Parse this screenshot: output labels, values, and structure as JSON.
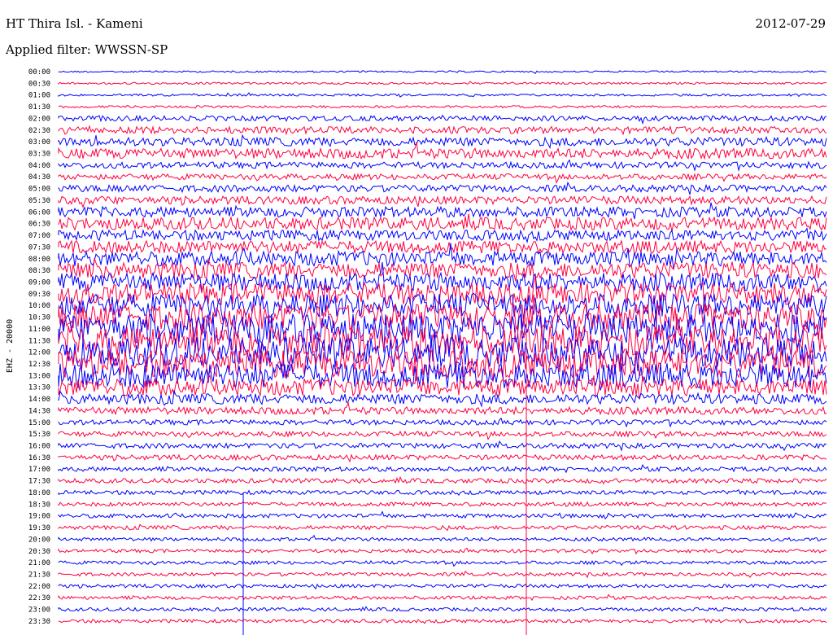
{
  "header": {
    "station": "HT Thira Isl. - Kameni",
    "date": "2012-07-29",
    "filter": "Applied filter: WWSSN-SP"
  },
  "chart_data": {
    "type": "line",
    "title": "HT Thira Isl. - Kameni",
    "date": "2012-07-29",
    "ylabel": "EHZ - 20000",
    "rows": [
      "00:00",
      "00:30",
      "01:00",
      "01:30",
      "02:00",
      "02:30",
      "03:00",
      "03:30",
      "04:00",
      "04:30",
      "05:00",
      "05:30",
      "06:00",
      "06:30",
      "07:00",
      "07:30",
      "08:00",
      "08:30",
      "09:00",
      "09:30",
      "10:00",
      "10:30",
      "11:00",
      "11:30",
      "12:00",
      "12:30",
      "13:00",
      "13:30",
      "14:00",
      "14:30",
      "15:00",
      "15:30",
      "16:00",
      "16:30",
      "17:00",
      "17:30",
      "18:00",
      "18:30",
      "19:00",
      "19:30",
      "20:00",
      "20:30",
      "21:00",
      "21:30",
      "22:00",
      "22:30",
      "23:00",
      "23:30"
    ],
    "series_colors": [
      "#0000ff",
      "#ff0040"
    ],
    "relative_amplitude": [
      0.15,
      0.18,
      0.2,
      0.2,
      0.45,
      0.6,
      0.75,
      0.9,
      0.55,
      0.5,
      0.6,
      0.7,
      0.9,
      1.1,
      0.9,
      1.1,
      1.3,
      1.4,
      1.6,
      1.9,
      2.0,
      2.3,
      2.6,
      2.6,
      2.6,
      2.4,
      2.2,
      1.5,
      0.9,
      0.65,
      0.45,
      0.45,
      0.45,
      0.45,
      0.4,
      0.4,
      0.35,
      0.35,
      0.35,
      0.35,
      0.3,
      0.3,
      0.3,
      0.3,
      0.3,
      0.3,
      0.3,
      0.3
    ]
  }
}
